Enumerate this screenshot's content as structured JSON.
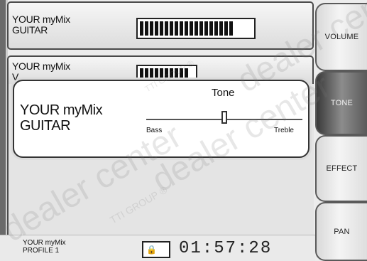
{
  "channels": [
    {
      "name_line1": "YOUR myMix",
      "name_line2": "GUITAR",
      "meter_level": 0.88
    },
    {
      "name_line1": "YOUR myMix",
      "name_line2": "V",
      "meter_level": 0.45
    }
  ],
  "tone_popup": {
    "name_line1": "YOUR myMix",
    "name_line2": "GUITAR",
    "title": "Tone",
    "min_label": "Bass",
    "max_label": "Treble",
    "value": 0.5
  },
  "side_buttons": [
    {
      "label": "VOLUME",
      "active": false
    },
    {
      "label": "TONE",
      "active": true
    },
    {
      "label": "EFFECT",
      "active": false
    },
    {
      "label": "PAN",
      "active": false
    }
  ],
  "status_bar": {
    "profile_line1": "YOUR myMix",
    "profile_line2": "PROFILE 1",
    "lock_symbol": "🔒",
    "time": "01:57:28"
  },
  "watermark": {
    "text_large": "dealer center",
    "text_small": "TTI GROUP ®"
  },
  "colors": {
    "active_button": "#3a3a3a",
    "meter": "#111111"
  }
}
